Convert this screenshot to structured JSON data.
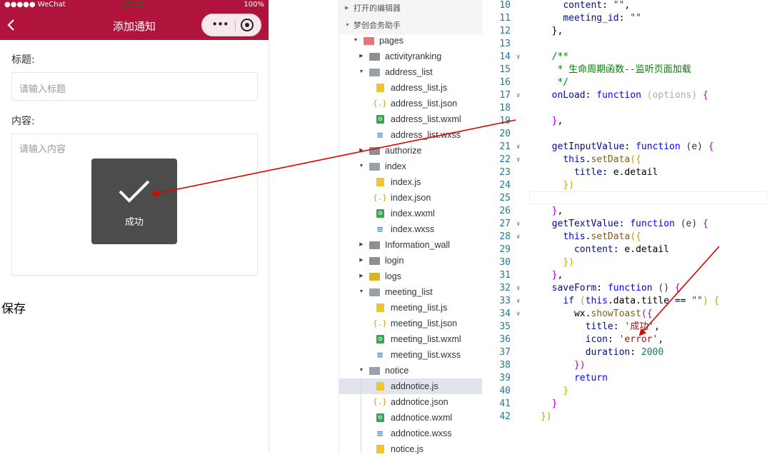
{
  "phone": {
    "status": {
      "carrier": "●●●●● WeChat",
      "wifi": "ᯤ",
      "time": "17:10",
      "battery": "100%"
    },
    "nav_title": "添加通知",
    "back_icon": "chevron-left-icon",
    "capsule_more": "•••",
    "title_label": "标题:",
    "title_placeholder": "请输入标题",
    "content_label": "内容:",
    "content_placeholder": "请输入内容",
    "toast_text": "成功",
    "save_label": "保存",
    "colors": {
      "nav_bg": "#b0143c",
      "toast_bg": "#4c4c4c"
    }
  },
  "explorer": {
    "open_editors": "打开的编辑器",
    "project": "梦创会务助手",
    "items": [
      {
        "name": "pages",
        "kind": "folder-red",
        "expanded": true
      },
      {
        "name": "activityranking",
        "kind": "folder",
        "expanded": false
      },
      {
        "name": "address_list",
        "kind": "folder",
        "expanded": true
      },
      {
        "name": "address_list.js",
        "kind": "js"
      },
      {
        "name": "address_list.json",
        "kind": "json"
      },
      {
        "name": "address_list.wxml",
        "kind": "wxml"
      },
      {
        "name": "address_list.wxss",
        "kind": "wxss"
      },
      {
        "name": "authorize",
        "kind": "folder",
        "expanded": false
      },
      {
        "name": "index",
        "kind": "folder",
        "expanded": true
      },
      {
        "name": "index.js",
        "kind": "js"
      },
      {
        "name": "index.json",
        "kind": "json"
      },
      {
        "name": "index.wxml",
        "kind": "wxml"
      },
      {
        "name": "index.wxss",
        "kind": "wxss"
      },
      {
        "name": "Information_wall",
        "kind": "folder",
        "expanded": false
      },
      {
        "name": "login",
        "kind": "folder",
        "expanded": false
      },
      {
        "name": "logs",
        "kind": "folder-yellow",
        "expanded": false
      },
      {
        "name": "meeting_list",
        "kind": "folder",
        "expanded": true
      },
      {
        "name": "meeting_list.js",
        "kind": "js"
      },
      {
        "name": "meeting_list.json",
        "kind": "json"
      },
      {
        "name": "meeting_list.wxml",
        "kind": "wxml"
      },
      {
        "name": "meeting_list.wxss",
        "kind": "wxss"
      },
      {
        "name": "notice",
        "kind": "folder",
        "expanded": true
      },
      {
        "name": "addnotice.js",
        "kind": "js",
        "selected": true
      },
      {
        "name": "addnotice.json",
        "kind": "json"
      },
      {
        "name": "addnotice.wxml",
        "kind": "wxml"
      },
      {
        "name": "addnotice.wxss",
        "kind": "wxss"
      },
      {
        "name": "notice.js",
        "kind": "js"
      }
    ]
  },
  "editor": {
    "lines": [
      {
        "n": "10",
        "fold": false,
        "html": "    <span class='pr'>content</span>: <span class='s'>\"\"</span>,"
      },
      {
        "n": "11",
        "fold": false,
        "html": "    <span class='pr'>meeting_id</span>: <span class='s'>\"\"</span>"
      },
      {
        "n": "12",
        "fold": false,
        "html": "  },"
      },
      {
        "n": "13",
        "fold": false,
        "html": ""
      },
      {
        "n": "14",
        "fold": true,
        "html": "  <span class='c'>/**</span>"
      },
      {
        "n": "15",
        "fold": false,
        "html": "<span class='c'>   * 生命周期函数--监听页面加载</span>"
      },
      {
        "n": "16",
        "fold": false,
        "html": "<span class='c'>   */</span>"
      },
      {
        "n": "17",
        "fold": true,
        "html": "  <span class='pr'>onLoad</span>: <span class='k'>function</span> <span class='g'>(options)</span> <span class='m'>{</span>"
      },
      {
        "n": "18",
        "fold": false,
        "html": ""
      },
      {
        "n": "19",
        "fold": false,
        "html": "  <span class='m'>}</span>,"
      },
      {
        "n": "20",
        "fold": false,
        "html": ""
      },
      {
        "n": "21",
        "fold": true,
        "html": "  <span class='pr'>getInputValue</span>: <span class='k'>function</span> <span class='p'>(e)</span> <span class='m'>{</span>"
      },
      {
        "n": "22",
        "fold": true,
        "html": "    <span class='k'>this</span>.<span class='fn'>setData</span><span class='y'>({</span>"
      },
      {
        "n": "23",
        "fold": false,
        "html": "      <span class='pr'>title</span>: e.detail"
      },
      {
        "n": "24",
        "fold": false,
        "html": "    <span class='y'>})</span>"
      },
      {
        "n": "25",
        "fold": false,
        "html": ""
      },
      {
        "n": "26",
        "fold": false,
        "html": "  <span class='m'>}</span>,"
      },
      {
        "n": "27",
        "fold": true,
        "html": "  <span class='pr'>getTextValue</span>: <span class='k'>function</span> <span class='p'>(e)</span> <span class='m'>{</span>"
      },
      {
        "n": "28",
        "fold": true,
        "html": "    <span class='k'>this</span>.<span class='fn'>setData</span><span class='y'>({</span>"
      },
      {
        "n": "29",
        "fold": false,
        "html": "      <span class='pr'>content</span>: e.detail"
      },
      {
        "n": "30",
        "fold": false,
        "html": "    <span class='y'>})</span>"
      },
      {
        "n": "31",
        "fold": false,
        "html": "  <span class='m'>}</span>,"
      },
      {
        "n": "32",
        "fold": true,
        "html": "  <span class='pr'>saveForm</span>: <span class='k'>function</span> <span class='p'>()</span> <span class='m'>{</span>"
      },
      {
        "n": "33",
        "fold": true,
        "html": "    <span class='k'>if</span> <span class='y'>(</span><span class='k'>this</span>.data.title == <span class='s'>\"\"</span><span class='y'>)</span> <span class='y'>{</span>"
      },
      {
        "n": "34",
        "fold": true,
        "html": "      wx.<span class='fn'>showToast</span><span class='m'>({</span>"
      },
      {
        "n": "35",
        "fold": false,
        "html": "        <span class='pr'>title</span>: <span class='s'>'成功'</span>,"
      },
      {
        "n": "36",
        "fold": false,
        "html": "        <span class='pr'>icon</span>: <span class='s'>'error'</span>,"
      },
      {
        "n": "37",
        "fold": false,
        "html": "        <span class='pr'>duration</span>: <span class='n'>2000</span>"
      },
      {
        "n": "38",
        "fold": false,
        "html": "      <span class='m'>})</span>"
      },
      {
        "n": "39",
        "fold": false,
        "html": "      <span class='k'>return</span>"
      },
      {
        "n": "40",
        "fold": false,
        "html": "    <span class='y'>}</span>"
      },
      {
        "n": "41",
        "fold": false,
        "html": "  <span class='m'>}</span>"
      },
      {
        "n": "42",
        "fold": false,
        "html": "<span class='y'>})</span>"
      }
    ]
  },
  "annotation_color": "#e00000"
}
